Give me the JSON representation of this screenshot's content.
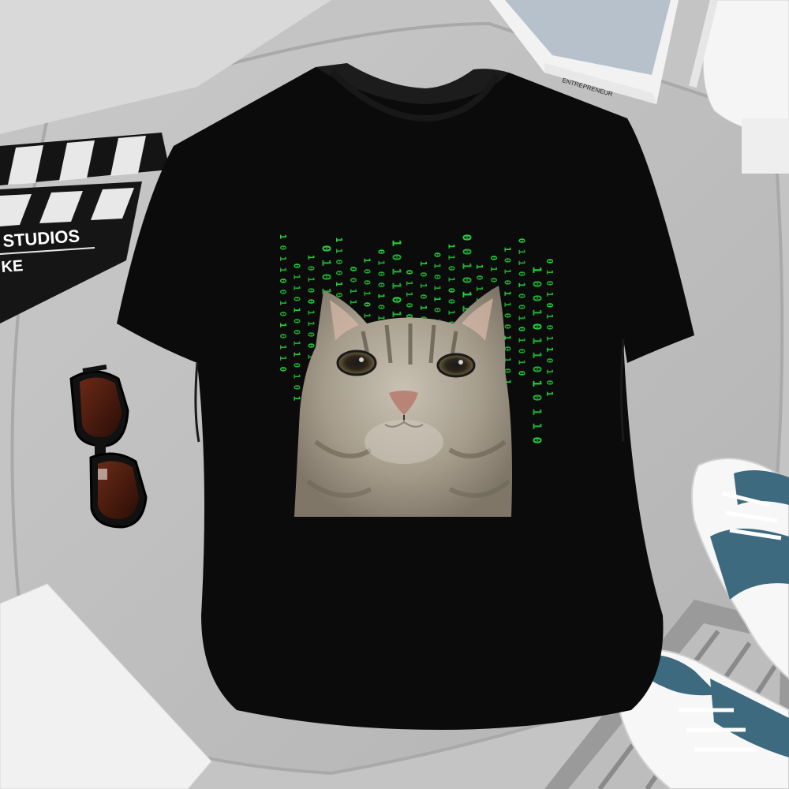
{
  "clapperboard": {
    "text_studios": "STUDIOS",
    "text_partial": "KE"
  },
  "book": {
    "spine_text": "ENTREPRENEUR"
  },
  "tshirt": {
    "color": "#0b0b0b",
    "print": {
      "code_color": "#22d03a",
      "code_columns": [
        "1011001010110",
        "0110100110101",
        "1010011001011",
        "0101100101101",
        "1100101011010",
        "0011010100110",
        "1001011010011",
        "0100101101100",
        "1011010010110",
        "0110011010101",
        "1010100101101",
        "0101101010010",
        "1101001011010",
        "0010110100101",
        "1011010101011",
        "0100101011100",
        "1010110010101",
        "0110100101010",
        "1001011010110",
        "0101010110101"
      ]
    }
  },
  "palette": {
    "background": "#cfcfcf",
    "cushion": "#bdbdbd",
    "shoe_accent": "#3e6a80",
    "lens": "#4a1e12"
  }
}
